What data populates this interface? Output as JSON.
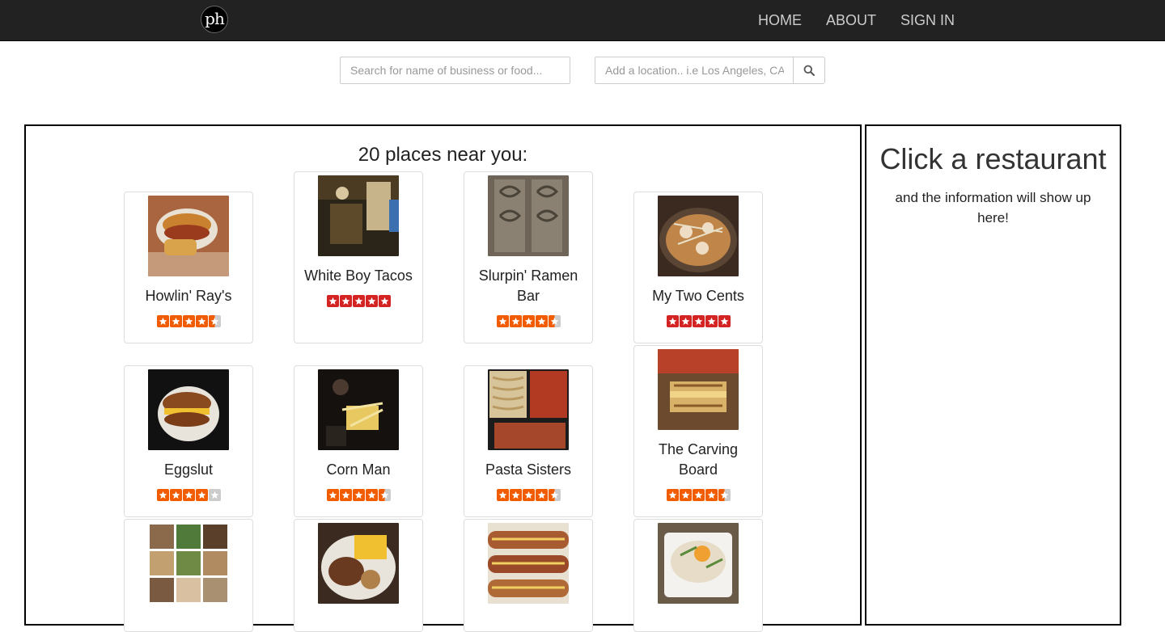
{
  "nav": {
    "logo_text": "ph",
    "links": [
      "HOME",
      "ABOUT",
      "SIGN IN"
    ]
  },
  "search": {
    "food_placeholder": "Search for name of business or food...",
    "location_placeholder": "Add a location.. i.e Los Angeles, CA",
    "button_icon": "search-icon"
  },
  "results": {
    "title": "20 places near you:",
    "items": [
      {
        "name": "Howlin' Ray's",
        "rating": 4.5,
        "photo": "fried-chicken-sandwich"
      },
      {
        "name": "White Boy Tacos",
        "rating": 5,
        "photo": "street-stand"
      },
      {
        "name": "Slurpin' Ramen Bar",
        "rating": 4.5,
        "photo": "carved-door"
      },
      {
        "name": "My Two Cents",
        "rating": 5,
        "photo": "shrimp-dish"
      },
      {
        "name": "Eggslut",
        "rating": 4,
        "photo": "egg-sandwich"
      },
      {
        "name": "Corn Man",
        "rating": 4.5,
        "photo": "night-corn"
      },
      {
        "name": "Pasta Sisters",
        "rating": 4.5,
        "photo": "pasta-trays"
      },
      {
        "name": "The Carving Board",
        "rating": 4.5,
        "photo": "grilled-sandwich"
      },
      {
        "name": "",
        "rating": 0,
        "photo": "collage"
      },
      {
        "name": "",
        "rating": 0,
        "photo": "plate-fries"
      },
      {
        "name": "",
        "rating": 0,
        "photo": "hot-dogs"
      },
      {
        "name": "",
        "rating": 0,
        "photo": "rice-bowl"
      }
    ]
  },
  "info": {
    "title": "Click a restaurant",
    "subtitle": "and the information will show up here!"
  },
  "colors": {
    "navbar": "#222222",
    "star_red": "#d32323",
    "star_orange": "#f15c00",
    "star_empty": "#cccccc"
  }
}
